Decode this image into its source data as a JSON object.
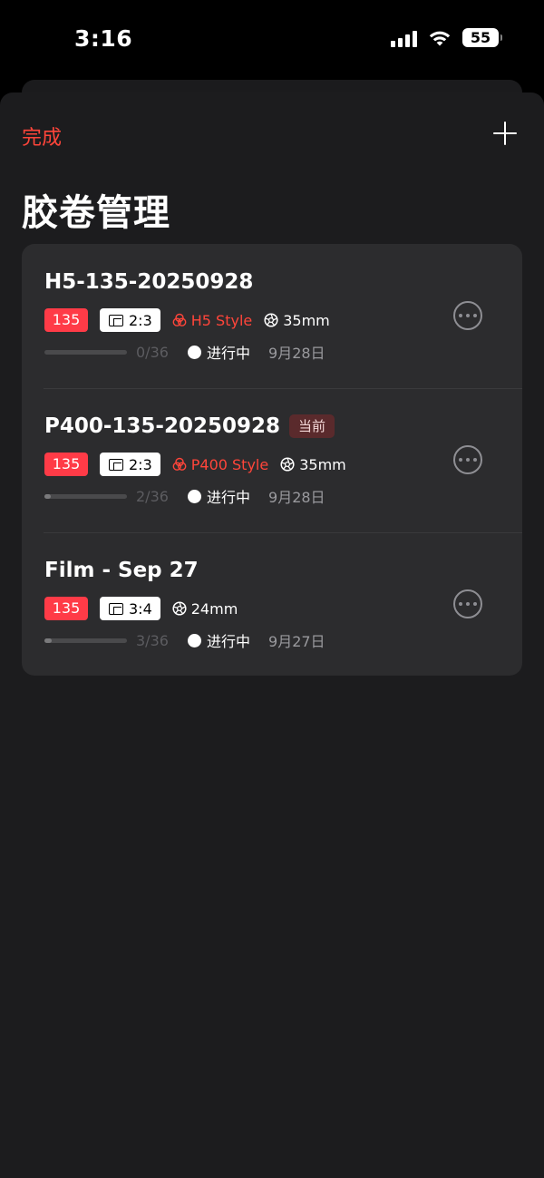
{
  "status_bar": {
    "time": "3:16",
    "battery": "55"
  },
  "header": {
    "done_label": "完成",
    "title": "胶卷管理"
  },
  "rolls": [
    {
      "name": "H5-135-20250928",
      "badge": "",
      "format": "135",
      "ratio": "2:3",
      "style": "H5 Style",
      "lens": "35mm",
      "progress": "0/36",
      "progress_value": 0,
      "progress_total": 36,
      "status": "进行中",
      "date": "9月28日"
    },
    {
      "name": "P400-135-20250928",
      "badge": "当前",
      "format": "135",
      "ratio": "2:3",
      "style": "P400 Style",
      "lens": "35mm",
      "progress": "2/36",
      "progress_value": 2,
      "progress_total": 36,
      "status": "进行中",
      "date": "9月28日"
    },
    {
      "name": "Film - Sep 27",
      "badge": "",
      "format": "135",
      "ratio": "3:4",
      "style": "",
      "lens": "24mm",
      "progress": "3/36",
      "progress_value": 3,
      "progress_total": 36,
      "status": "进行中",
      "date": "9月27日"
    }
  ],
  "colors": {
    "accent": "#ff453a",
    "format_tag": "#ff3b47",
    "background": "#1c1c1e",
    "card": "#2c2c2e"
  },
  "icons": {
    "style": "film-style-icon",
    "lens": "aperture-icon",
    "ratio": "aspect-ratio-icon",
    "more": "more-icon",
    "add": "plus-icon"
  }
}
